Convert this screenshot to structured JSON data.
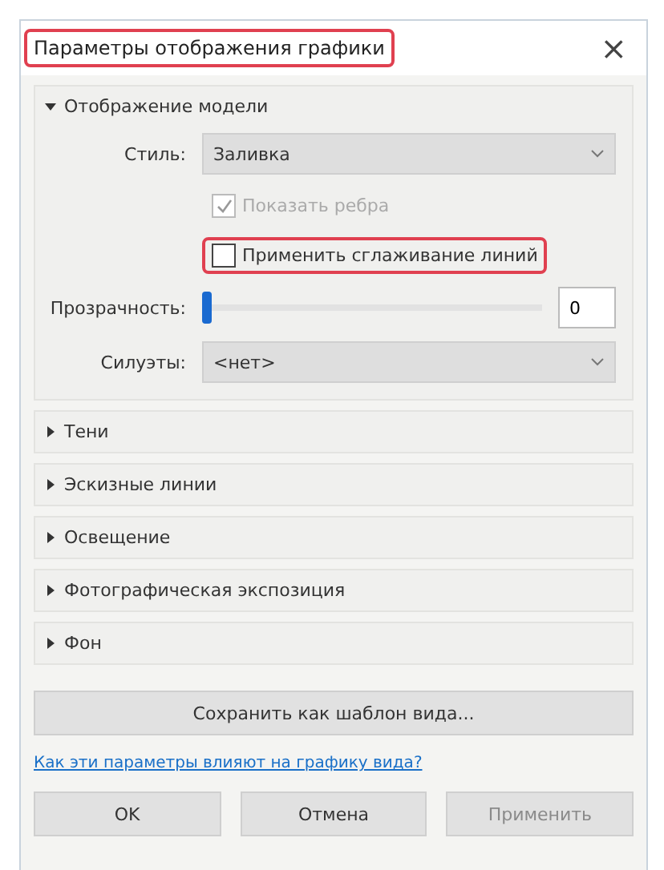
{
  "window": {
    "title": "Параметры отображения графики",
    "title_highlighted": true,
    "close": "×"
  },
  "model_section": {
    "title": "Отображение модели",
    "expanded": true,
    "style": {
      "label": "Стиль:",
      "value": "Заливка"
    },
    "show_edges": {
      "label": "Показать ребра",
      "checked": true,
      "disabled": true,
      "highlighted": false
    },
    "smooth_lines": {
      "label": "Применить сглаживание линий",
      "checked": false,
      "disabled": false,
      "highlighted": true
    },
    "transparency": {
      "label": "Прозрачность:",
      "level": 0,
      "value": "0"
    },
    "silhouettes": {
      "label": "Силуэты:",
      "value": "<нет>"
    }
  },
  "sections": [
    {
      "title": "Тени",
      "expanded": false
    },
    {
      "title": "Эскизные линии",
      "expanded": false
    },
    {
      "title": "Освещение",
      "expanded": false
    },
    {
      "title": "Фотографическая экспозиция",
      "expanded": false
    },
    {
      "title": "Фон",
      "expanded": false
    }
  ],
  "save_template_button": "Сохранить как шаблон вида...",
  "help_link": "Как эти параметры влияют на графику вида?",
  "buttons": [
    {
      "label": "OK",
      "disabled": false
    },
    {
      "label": "Отмена",
      "disabled": false
    },
    {
      "label": "Применить",
      "disabled": true
    }
  ]
}
